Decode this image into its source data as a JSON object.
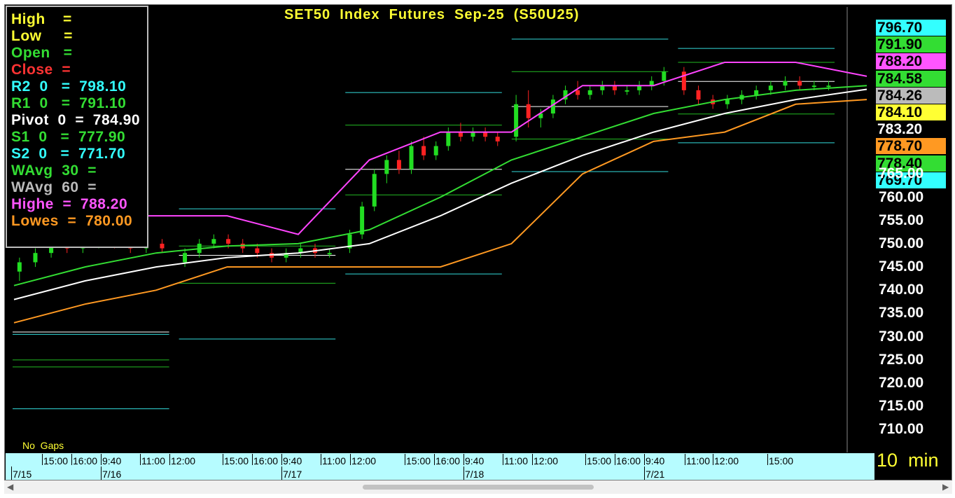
{
  "chart_data": {
    "type": "candlestick",
    "title": "SET50  Index  Futures  Sep-25  (S50U25)",
    "interval_label": "10  min",
    "gaps_label": "No  Gaps",
    "y_ticks": [
      "710.00",
      "715.00",
      "720.00",
      "725.00",
      "730.00",
      "735.00",
      "740.00",
      "745.00",
      "750.00",
      "755.00",
      "760.00",
      "765.00"
    ],
    "ylim": [
      706,
      800
    ],
    "sessions": [
      {
        "date": "7/15",
        "candles": [
          {
            "o": 744,
            "h": 747,
            "l": 742,
            "c": 746
          },
          {
            "o": 746,
            "h": 749,
            "l": 745,
            "c": 748
          },
          {
            "o": 748,
            "h": 751,
            "l": 747,
            "c": 750
          },
          {
            "o": 750,
            "h": 752,
            "l": 748,
            "c": 749
          },
          {
            "o": 749,
            "h": 751,
            "l": 748,
            "c": 750
          },
          {
            "o": 750,
            "h": 752,
            "l": 749,
            "c": 751
          },
          {
            "o": 751,
            "h": 752,
            "l": 749,
            "c": 750
          },
          {
            "o": 750,
            "h": 751,
            "l": 748,
            "c": 749
          },
          {
            "o": 749,
            "h": 751,
            "l": 748,
            "c": 750
          },
          {
            "o": 750,
            "h": 751,
            "l": 748,
            "c": 749
          }
        ]
      },
      {
        "date": "7/16",
        "candles": [
          {
            "o": 746,
            "h": 749,
            "l": 745,
            "c": 748
          },
          {
            "o": 748,
            "h": 751,
            "l": 747,
            "c": 750
          },
          {
            "o": 750,
            "h": 752,
            "l": 749,
            "c": 751
          },
          {
            "o": 751,
            "h": 752,
            "l": 749,
            "c": 750
          },
          {
            "o": 750,
            "h": 751,
            "l": 748,
            "c": 749
          },
          {
            "o": 749,
            "h": 750,
            "l": 747,
            "c": 748
          },
          {
            "o": 748,
            "h": 749,
            "l": 746,
            "c": 747
          },
          {
            "o": 747,
            "h": 749,
            "l": 746,
            "c": 748
          },
          {
            "o": 748,
            "h": 750,
            "l": 747,
            "c": 749
          },
          {
            "o": 749,
            "h": 750,
            "l": 747,
            "c": 748
          },
          {
            "o": 748,
            "h": 749,
            "l": 747,
            "c": 748
          }
        ]
      },
      {
        "date": "7/17",
        "candles": [
          {
            "o": 749,
            "h": 753,
            "l": 748,
            "c": 752
          },
          {
            "o": 752,
            "h": 759,
            "l": 751,
            "c": 758
          },
          {
            "o": 758,
            "h": 766,
            "l": 757,
            "c": 765
          },
          {
            "o": 765,
            "h": 769,
            "l": 763,
            "c": 768
          },
          {
            "o": 768,
            "h": 770,
            "l": 765,
            "c": 766
          },
          {
            "o": 766,
            "h": 772,
            "l": 765,
            "c": 771
          },
          {
            "o": 771,
            "h": 773,
            "l": 768,
            "c": 769
          },
          {
            "o": 769,
            "h": 772,
            "l": 768,
            "c": 771
          },
          {
            "o": 771,
            "h": 775,
            "l": 770,
            "c": 774
          },
          {
            "o": 774,
            "h": 776,
            "l": 772,
            "c": 773
          },
          {
            "o": 773,
            "h": 775,
            "l": 772,
            "c": 774
          },
          {
            "o": 774,
            "h": 775,
            "l": 772,
            "c": 773
          },
          {
            "o": 773,
            "h": 774,
            "l": 771,
            "c": 772
          }
        ]
      },
      {
        "date": "7/18",
        "candles": [
          {
            "o": 773,
            "h": 782,
            "l": 772,
            "c": 780
          },
          {
            "o": 780,
            "h": 783,
            "l": 775,
            "c": 777
          },
          {
            "o": 777,
            "h": 779,
            "l": 775,
            "c": 778
          },
          {
            "o": 778,
            "h": 782,
            "l": 777,
            "c": 781
          },
          {
            "o": 781,
            "h": 784,
            "l": 780,
            "c": 783
          },
          {
            "o": 783,
            "h": 785,
            "l": 781,
            "c": 782
          },
          {
            "o": 782,
            "h": 784,
            "l": 781,
            "c": 783
          },
          {
            "o": 783,
            "h": 785,
            "l": 782,
            "c": 784
          },
          {
            "o": 784,
            "h": 785,
            "l": 782,
            "c": 783
          },
          {
            "o": 783,
            "h": 784,
            "l": 782,
            "c": 783
          },
          {
            "o": 783,
            "h": 785,
            "l": 782,
            "c": 784
          },
          {
            "o": 784,
            "h": 786,
            "l": 783,
            "c": 785
          },
          {
            "o": 785,
            "h": 788,
            "l": 784,
            "c": 787
          }
        ]
      },
      {
        "date": "7/21",
        "candles": [
          {
            "o": 787,
            "h": 788,
            "l": 782,
            "c": 783
          },
          {
            "o": 783,
            "h": 784,
            "l": 780,
            "c": 781
          },
          {
            "o": 781,
            "h": 782,
            "l": 779,
            "c": 780
          },
          {
            "o": 780,
            "h": 782,
            "l": 779,
            "c": 781
          },
          {
            "o": 781,
            "h": 783,
            "l": 780,
            "c": 782
          },
          {
            "o": 782,
            "h": 784,
            "l": 781,
            "c": 783
          },
          {
            "o": 783,
            "h": 785,
            "l": 782,
            "c": 784
          },
          {
            "o": 784,
            "h": 786,
            "l": 783,
            "c": 785
          },
          {
            "o": 785,
            "h": 786,
            "l": 783,
            "c": 784
          },
          {
            "o": 784,
            "h": 785,
            "l": 783,
            "c": 784
          },
          {
            "o": 784,
            "h": 785,
            "l": 783,
            "c": 784
          }
        ]
      }
    ],
    "time_ticks": [
      "15:00",
      "16:00",
      "9:40",
      "11:00",
      "12:00",
      "15:00",
      "16:00",
      "9:40",
      "11:00",
      "12:00",
      "15:00",
      "16:00",
      "9:40",
      "11:00",
      "12:00",
      "15:00",
      "16:00",
      "9:40",
      "11:00",
      "12:00",
      "15:00"
    ],
    "date_ticks": [
      "7/15",
      "7/16",
      "7/17",
      "7/18",
      "7/21"
    ],
    "pivot_levels": {
      "r2": [
        730.5,
        757.5,
        782.5,
        794.0,
        792.0
      ],
      "r1": [
        723.5,
        749.5,
        775.5,
        787.0,
        789.0
      ],
      "pivot": [
        731.0,
        747.5,
        766.0,
        779.5,
        784.9
      ],
      "s1": [
        725.0,
        741.5,
        760.5,
        772.5,
        777.9
      ],
      "s2": [
        714.5,
        729.5,
        743.5,
        765.5,
        771.7
      ]
    },
    "series": [
      {
        "name": "WAvg 30",
        "color": "#33dd33",
        "values": [
          741,
          745,
          748,
          749.5,
          750,
          753,
          760,
          768,
          773,
          778,
          781,
          783,
          784
        ]
      },
      {
        "name": "WAvg 60",
        "color": "#ffffff",
        "values": [
          738,
          742,
          745,
          747,
          748,
          750,
          756,
          763,
          769,
          774,
          778,
          781,
          783.2
        ]
      },
      {
        "name": "Highe",
        "color": "#ff44ff",
        "values": [
          756,
          756,
          756,
          756,
          752,
          768,
          774,
          774,
          784,
          784,
          789,
          789,
          786
        ]
      },
      {
        "name": "Lowes",
        "color": "#ff9922",
        "values": [
          733,
          737,
          740,
          745,
          745,
          745,
          745,
          750,
          765,
          772,
          774,
          780,
          781
        ]
      }
    ]
  },
  "info_box": {
    "high": "High    =",
    "low": "Low     =",
    "open": "Open   =",
    "close": "Close  =",
    "r2": "R2  0   =  798.10",
    "r1": "R1  0   =  791.10",
    "pivot": "Pivot  0  =  784.90",
    "s1": "S1  0   =  777.90",
    "s2": "S2  0   =  771.70",
    "wavg30": "WAvg  30  =",
    "wavg60": "WAvg  60  =",
    "highe": "Highe  =  788.20",
    "lowes": "Lowes  =  780.00"
  },
  "price_tags": [
    {
      "label": "796.70",
      "color": "#33ffff"
    },
    {
      "label": "791.90",
      "color": "#33dd33"
    },
    {
      "label": "788.20",
      "color": "#ff55ff"
    },
    {
      "label": "784.58",
      "color": "#33dd33"
    },
    {
      "label": "784.26",
      "color": "#bbbbbb"
    },
    {
      "label": "784.10",
      "color": "#ffff33"
    },
    {
      "label": "783.20",
      "color": "#ffffff"
    },
    {
      "label": "778.70",
      "color": "#ff9922"
    },
    {
      "label": "778.40",
      "color": "#33dd33"
    },
    {
      "label": "769.70",
      "color": "#33ffff"
    }
  ],
  "colors": {
    "up": "#22dd22",
    "down": "#ff2222",
    "r_level": "#33dddd",
    "s_level": "#22bb22",
    "pivot": "#ffffff",
    "background": "#000000",
    "axis_band": "#b6fcff"
  },
  "scrollbar": {
    "left_arrow": "◀",
    "right_arrow": "▶"
  }
}
